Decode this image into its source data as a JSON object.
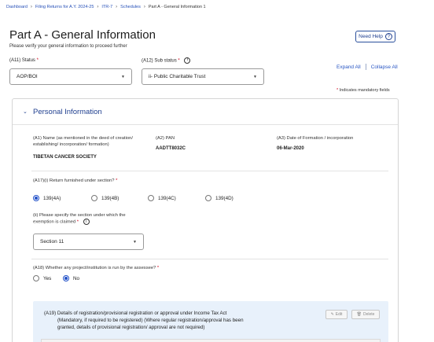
{
  "breadcrumb": {
    "items": [
      "Dashboard",
      "Filing Returns for A.Y. 2024-25",
      "ITR-7",
      "Schedules"
    ],
    "current": "Part A - General Information 1",
    "separator": "›"
  },
  "header": {
    "title": "Part A - General Information",
    "subtitle": "Please verify your general information to proceed further",
    "help_label": "Need Help",
    "help_icon": "?"
  },
  "status": {
    "label": "(A11) Status",
    "value": "AOP/BOI"
  },
  "sub_status": {
    "label": "(A12) Sub status",
    "value": "ii- Public Charitable Trust"
  },
  "controls": {
    "expand_all": "Expand All",
    "collapse_all": "Collapse All",
    "mandatory_note": "Indicates mandatory fields",
    "required_mark": "*",
    "info_mark": "i",
    "caret": "▼"
  },
  "section": {
    "title": "Personal Information",
    "chevron": "⌄",
    "name_label_line1": "(A1) Name (as mentioned in the deed of creation/",
    "name_label_line2": "establishing/ incorporation/ formation)",
    "name_value": "TIBETAN CANCER SOCIETY",
    "pan_label": "(A2) PAN",
    "pan_value": "AADTT8032C",
    "formation_label": "(A3) Date of Formation / incorporation",
    "formation_value": "06-Mar-2020",
    "return_section_label": "(A17)(i) Return furnished under section?",
    "return_options": [
      {
        "label": "139(4A)",
        "selected": true
      },
      {
        "label": "139(4B)",
        "selected": false
      },
      {
        "label": "139(4C)",
        "selected": false
      },
      {
        "label": "139(4D)",
        "selected": false
      }
    ],
    "exemption_label_line1": "(ii) Please specify the section under which the",
    "exemption_label_line2": "exemption is claimed",
    "exemption_value": "Section 11",
    "project_label": "(A18) Whether any project/institution is run by the assessee?",
    "project_options": [
      {
        "label": "Yes",
        "selected": false
      },
      {
        "label": "No",
        "selected": true
      }
    ],
    "registration_code": "(A19)",
    "registration_line1": "Details of registration/provisional registration or approval under Income Tax Act",
    "registration_line2": "(Mandatory, if required to be registered) (Where regular registration/approval has been",
    "registration_line3": "granted, details of provisional registration/ approval are not required)",
    "edit_label": "Edit",
    "delete_label": "Delete"
  },
  "colors": {
    "primary": "#1f3f8f",
    "link": "#2650b8",
    "required": "#d0021b",
    "info_box": "#e8f1fb"
  }
}
